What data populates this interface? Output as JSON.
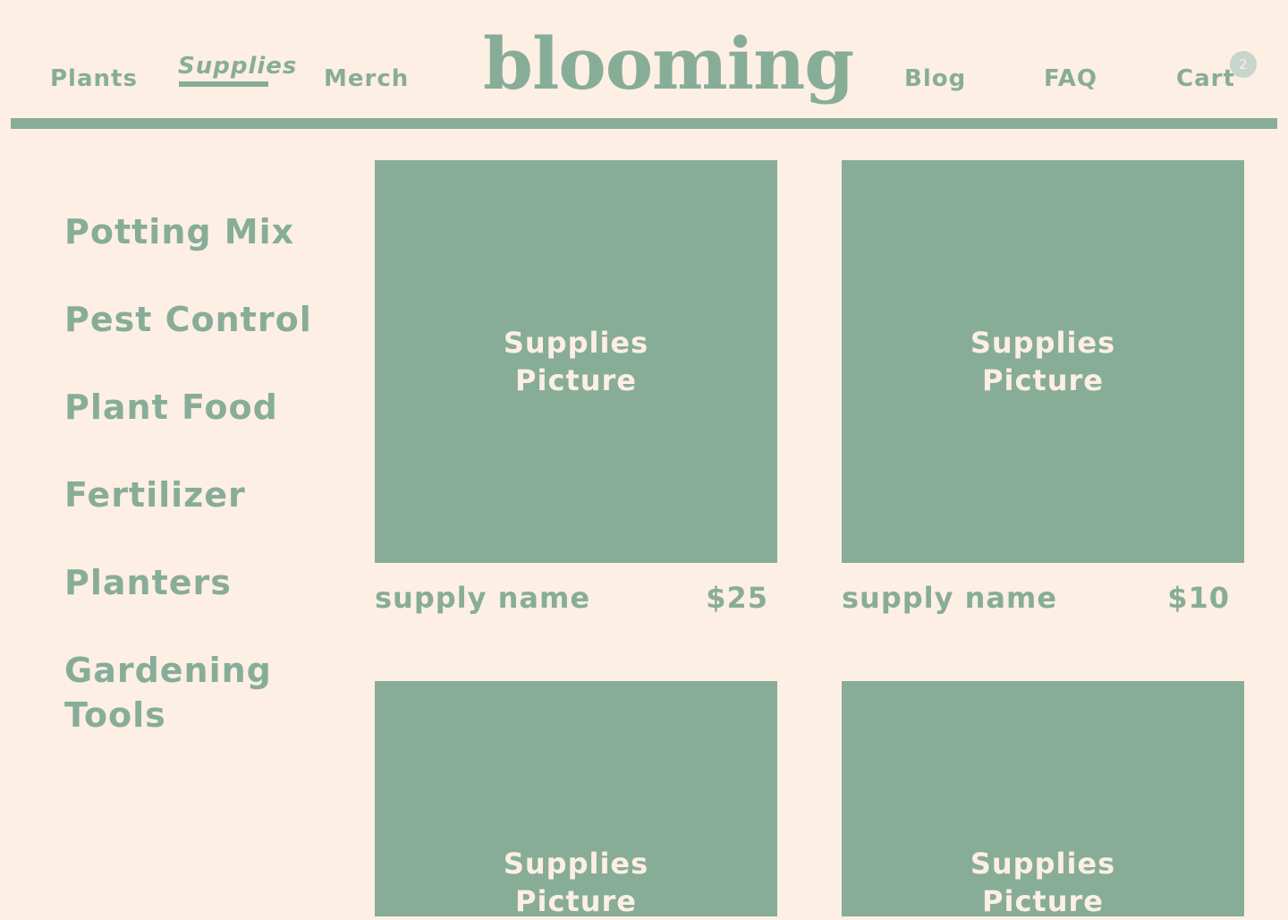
{
  "header": {
    "logo": "blooming",
    "nav_left": [
      "Plants",
      "Supplies",
      "Merch"
    ],
    "nav_right": [
      "Blog",
      "FAQ",
      "Cart"
    ],
    "active_nav": "Supplies",
    "cart_count": "2"
  },
  "sidebar": {
    "categories": [
      "Potting Mix",
      "Pest Control",
      "Plant Food",
      "Fertilizer",
      "Planters",
      "Gardening Tools"
    ]
  },
  "products": [
    {
      "image_label_line1": "Supplies",
      "image_label_line2": "Picture",
      "name": "supply name",
      "price": "$25"
    },
    {
      "image_label_line1": "Supplies",
      "image_label_line2": "Picture",
      "name": "supply name",
      "price": "$10"
    },
    {
      "image_label_line1": "Supplies",
      "image_label_line2": "Picture"
    },
    {
      "image_label_line1": "Supplies",
      "image_label_line2": "Picture"
    }
  ],
  "colors": {
    "background": "#FDEFE3",
    "accent": "#87AD98",
    "badge": "#C6D6CB"
  }
}
